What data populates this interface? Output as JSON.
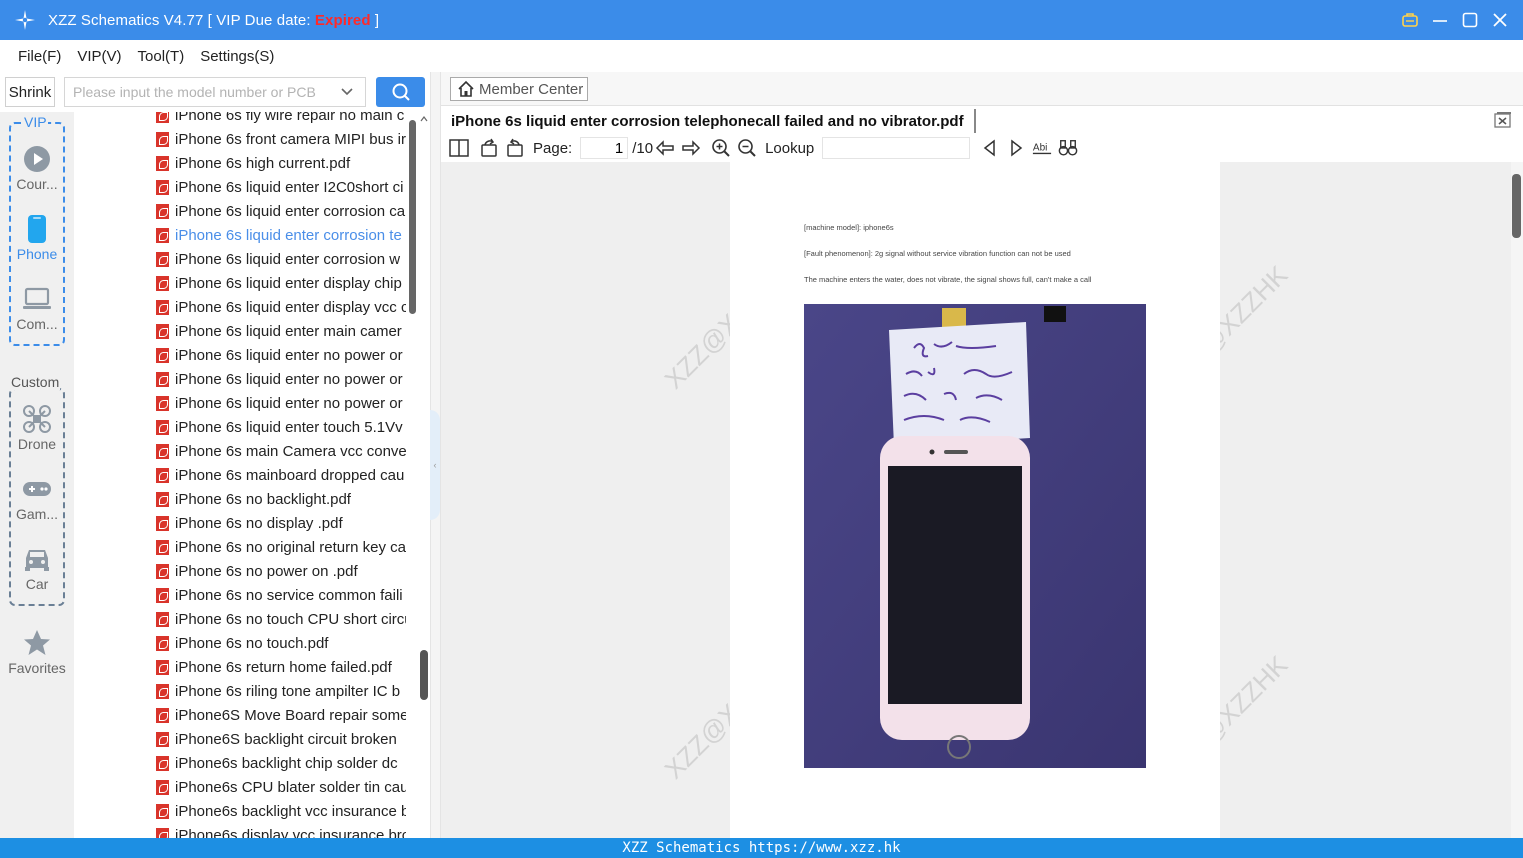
{
  "titlebar": {
    "title_prefix": "XZZ Schematics V4.77 [ VIP Due date: ",
    "status": "Expired",
    "title_suffix": " ]",
    "accent": "#3b8ce9",
    "expired_color": "#ff2a2a"
  },
  "menu": [
    "File(F)",
    "VIP(V)",
    "Tool(T)",
    "Settings(S)"
  ],
  "search": {
    "shrink_label": "Shrink",
    "placeholder": "Please input the model number or PCB",
    "search_icon": "search-icon"
  },
  "rail": {
    "vip_label": "VIP",
    "custom_label": "Custom",
    "vip_items": [
      {
        "label": "Cour...",
        "icon": "play-icon"
      },
      {
        "label": "Phone",
        "icon": "phone-icon"
      },
      {
        "label": "Com...",
        "icon": "laptop-icon"
      }
    ],
    "custom_items": [
      {
        "label": "Drone",
        "icon": "drone-icon"
      },
      {
        "label": "Gam...",
        "icon": "gamepad-icon"
      },
      {
        "label": "Car",
        "icon": "car-icon"
      }
    ],
    "favorites_label": "Favorites"
  },
  "files": [
    "iPhone 6s fly wire repair no main c",
    "iPhone 6s front camera MIPI bus ir",
    "iPhone 6s high current.pdf",
    "iPhone 6s liquid enter I2C0short ci",
    "iPhone 6s liquid enter corrosion ca",
    "iPhone 6s liquid enter corrosion te",
    "iPhone 6s liquid enter corrosion w",
    "iPhone 6s liquid enter display chip",
    "iPhone 6s liquid enter display vcc c",
    "iPhone 6s liquid enter main camer",
    "iPhone 6s liquid enter no power or",
    "iPhone 6s liquid enter no power or",
    "iPhone 6s liquid enter no power or",
    "iPhone 6s liquid enter touch 5.1Vv",
    "iPhone 6s main Camera vcc conver",
    "iPhone 6s mainboard dropped cau",
    "iPhone 6s no backlight.pdf",
    "iPhone 6s no display  .pdf",
    "iPhone 6s no original return key ca",
    "iPhone 6s no power on .pdf",
    "iPhone 6s no service common faili",
    "iPhone 6s no touch CPU short circu",
    "iPhone 6s no touch.pdf",
    "iPhone 6s return home failed.pdf",
    "iPhone 6s riling tone ampilter IC b",
    "iPhone6S Move Board repair some",
    "iPhone6S backlight circuit broken",
    "iPhone6s  backlight chip solder dc",
    "iPhone6s CPU blater solder tin cau",
    "iPhone6s backlight vcc insurance b",
    "iPhone6s display vcc insurance bro"
  ],
  "selected_file_index": 5,
  "right": {
    "member_center": "Member Center",
    "doc_title": "iPhone 6s liquid enter corrosion telephonecall failed and no vibrator.pdf",
    "page_label": "Page:",
    "page_current": "1",
    "page_total": "/10",
    "lookup_label": "Lookup"
  },
  "pdf_page": {
    "line1": "[machine model]: iphone6s",
    "line2": "[Fault phenomenon]: 2g signal without service vibration function can not be used",
    "line3": "The machine enters the water, does not vibrate, the signal shows full, can't make a call",
    "watermark": "XZZ@XZZHK"
  },
  "statusbar": "XZZ Schematics https://www.xzz.hk"
}
